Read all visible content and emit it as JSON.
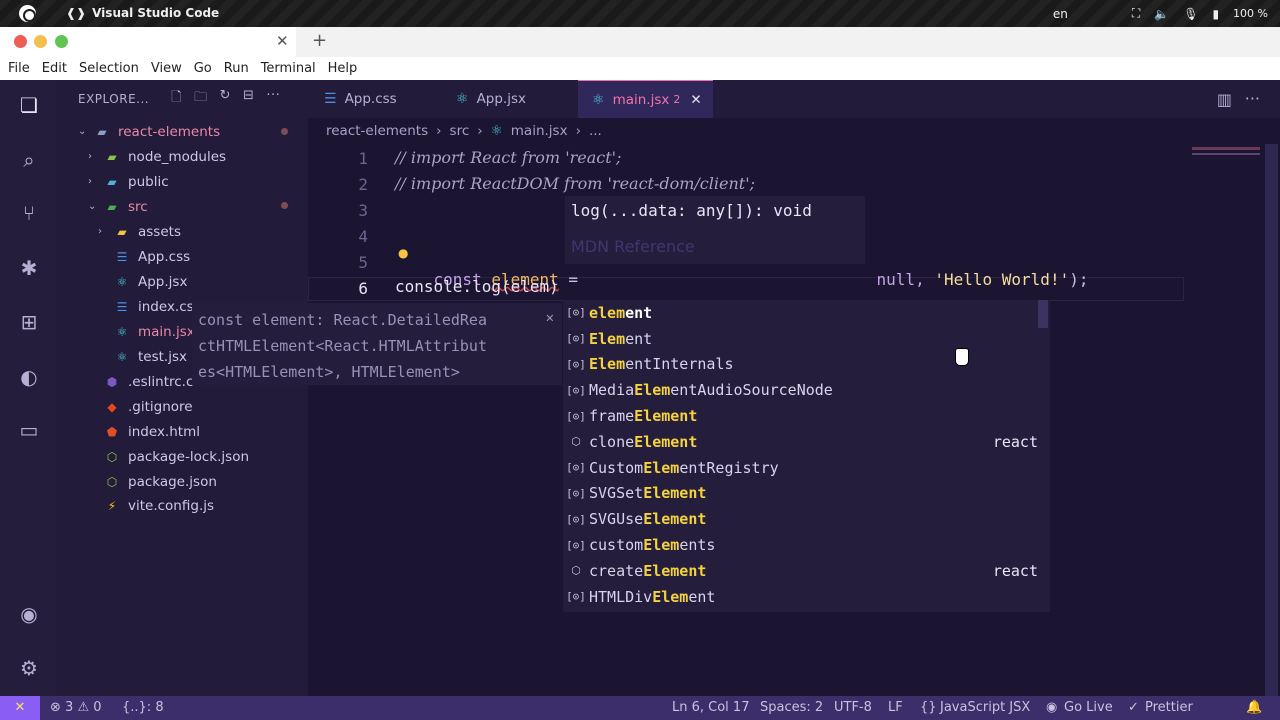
{
  "os": {
    "app_name": "Visual Studio Code",
    "lang": "en",
    "battery": "100 %"
  },
  "menu": [
    "File",
    "Edit",
    "Selection",
    "View",
    "Go",
    "Run",
    "Terminal",
    "Help"
  ],
  "sidebar": {
    "title": "EXPLORE...",
    "root": "react-elements",
    "items": [
      {
        "label": "node_modules",
        "type": "folder"
      },
      {
        "label": "public",
        "type": "folder"
      },
      {
        "label": "src",
        "type": "folder-open"
      },
      {
        "label": "assets",
        "type": "folder"
      },
      {
        "label": "App.css",
        "type": "css"
      },
      {
        "label": "App.jsx",
        "type": "react"
      },
      {
        "label": "index.cs",
        "type": "css"
      },
      {
        "label": "main.jsx",
        "type": "react"
      },
      {
        "label": "test.jsx",
        "type": "react"
      },
      {
        "label": ".eslintrc.c",
        "type": "eslint"
      },
      {
        "label": ".gitignore",
        "type": "git"
      },
      {
        "label": "index.html",
        "type": "html"
      },
      {
        "label": "package-lock.json",
        "type": "json"
      },
      {
        "label": "package.json",
        "type": "json"
      },
      {
        "label": "vite.config.js",
        "type": "vite"
      }
    ]
  },
  "tabs": [
    {
      "label": "App.css"
    },
    {
      "label": "App.jsx"
    },
    {
      "label": "main.jsx",
      "badge": "2"
    }
  ],
  "breadcrumb": [
    "react-elements",
    "src",
    "main.jsx",
    "..."
  ],
  "code": {
    "line_numbers": [
      "1",
      "2",
      "3",
      "4",
      "5",
      "6"
    ],
    "l1": "// import React from 'react';",
    "l2": "// import ReactDOM from 'react-dom/client';",
    "l5_kw": "const",
    "l5_var": "element",
    "l5_eq": " =",
    "l5_null": "null,",
    "l5_str": "'Hello World!'",
    "l5_end": ");",
    "l6": "console.log(elem)"
  },
  "signature": {
    "text": "log(...data: any[]): void",
    "link": "MDN Reference"
  },
  "type_hover": {
    "line1": "const element: React.DetailedRea",
    "line2": "ctHTMLElement<React.HTMLAttribut",
    "line3": "es<HTMLElement>, HTMLElement>"
  },
  "suggestions": [
    {
      "pre": "",
      "match": "elem",
      "post": "ent",
      "detail": ""
    },
    {
      "pre": "",
      "match": "Elem",
      "post": "ent",
      "detail": ""
    },
    {
      "pre": "",
      "match": "Elem",
      "post": "entInternals",
      "detail": ""
    },
    {
      "pre": "Media",
      "match": "Elem",
      "post": "entAudioSourceNode",
      "detail": ""
    },
    {
      "pre": "frame",
      "match": "Element",
      "post": "",
      "detail": ""
    },
    {
      "pre": "clone",
      "match": "Element",
      "post": "",
      "detail": "react"
    },
    {
      "pre": "Custom",
      "match": "Elem",
      "post": "entRegistry",
      "detail": ""
    },
    {
      "pre": "SVGSet",
      "match": "Element",
      "post": "",
      "detail": ""
    },
    {
      "pre": "SVGUse",
      "match": "Element",
      "post": "",
      "detail": ""
    },
    {
      "pre": "custom",
      "match": "Elem",
      "post": "ents",
      "detail": ""
    },
    {
      "pre": "create",
      "match": "Element",
      "post": "",
      "detail": "react"
    },
    {
      "pre": "HTMLDiv",
      "match": "Elem",
      "post": "ent",
      "detail": ""
    }
  ],
  "status": {
    "errors": "3",
    "warnings": "0",
    "selection": "{..}: 8",
    "position": "Ln 6, Col 17",
    "spaces": "Spaces: 2",
    "encoding": "UTF-8",
    "eol": "LF",
    "language": "JavaScript JSX",
    "golive": "Go Live",
    "prettier": "Prettier"
  },
  "colors": {
    "accent": "#f273a9",
    "match": "#f4d33c",
    "status_bg": "#3b2e6b"
  }
}
